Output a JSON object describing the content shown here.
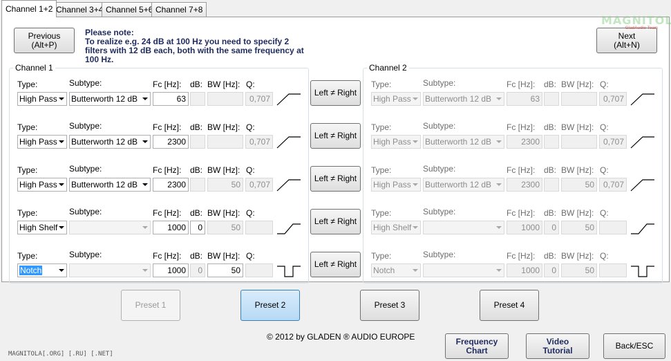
{
  "tabs": [
    "Channel 1+2",
    "Channel 3+4",
    "Channel 5+6",
    "Channel 7+8"
  ],
  "nav": {
    "previous_label": "Previous",
    "previous_hint": "(Alt+P)",
    "next_label": "Next",
    "next_hint": "(Alt+N)"
  },
  "note": {
    "title": "Please note:",
    "text": "To realize e.g. 24 dB at 100 Hz you need to specify 2 filters with 12 dB each, both with the same frequency at 100 Hz."
  },
  "logo": {
    "text": "MAGNITOLA",
    "subtext": "GladAudio Team"
  },
  "field_labels": {
    "type": "Type:",
    "subtype": "Subtype:",
    "fc": "Fc [Hz]:",
    "db": "dB:",
    "bw": "BW [Hz]:",
    "q": "Q:"
  },
  "link_button_label": "Left ≠ Right",
  "channel1": {
    "title": "Channel 1",
    "rows": [
      {
        "type": "High Pass",
        "subtype": "Butterworth 12 dB",
        "fc": "63",
        "db": "",
        "bw": "",
        "q": "0,707",
        "shape": "highpass"
      },
      {
        "type": "High Pass",
        "subtype": "Butterworth 12 dB",
        "fc": "2300",
        "db": "",
        "bw": "",
        "q": "0,707",
        "shape": "highpass"
      },
      {
        "type": "High Pass",
        "subtype": "Butterworth 12 dB",
        "fc": "2300",
        "db": "",
        "bw": "50",
        "q": "0,707",
        "shape": "highpass"
      },
      {
        "type": "High Shelf",
        "subtype": "",
        "fc": "1000",
        "db": "0",
        "bw": "50",
        "q": "",
        "shape": "highshelf"
      },
      {
        "type": "Notch",
        "subtype": "",
        "fc": "1000",
        "db": "0",
        "bw": "50",
        "q": "",
        "shape": "notch"
      }
    ]
  },
  "channel2": {
    "title": "Channel 2",
    "rows": [
      {
        "type": "High Pass",
        "subtype": "Butterworth 12 dB",
        "fc": "63",
        "db": "",
        "bw": "",
        "q": "0,707",
        "shape": "highpass"
      },
      {
        "type": "High Pass",
        "subtype": "Butterworth 12 dB",
        "fc": "2300",
        "db": "",
        "bw": "",
        "q": "0,707",
        "shape": "highpass"
      },
      {
        "type": "High Pass",
        "subtype": "Butterworth 12 dB",
        "fc": "2300",
        "db": "",
        "bw": "50",
        "q": "0,707",
        "shape": "highpass"
      },
      {
        "type": "High Shelf",
        "subtype": "",
        "fc": "1000",
        "db": "0",
        "bw": "50",
        "q": "",
        "shape": "highshelf"
      },
      {
        "type": "Notch",
        "subtype": "",
        "fc": "1000",
        "db": "0",
        "bw": "50",
        "q": "",
        "shape": "notch"
      }
    ]
  },
  "presets": [
    "Preset 1",
    "Preset 2",
    "Preset 3",
    "Preset 4"
  ],
  "copyright": "© 2012 by GLADEN ® AUDIO EUROPE",
  "bottom_buttons": {
    "frequency_chart": [
      "Frequency",
      "Chart"
    ],
    "video_tutorial": [
      "Video",
      "Tutorial"
    ],
    "back": "Back/ESC"
  },
  "watermark": "MAGNITOLA[.ORG] [.RU] [.NET]",
  "colors": {
    "note_text": "#1f2a5e",
    "selection": "#3399ff",
    "panel_bg": "#ffffff"
  }
}
